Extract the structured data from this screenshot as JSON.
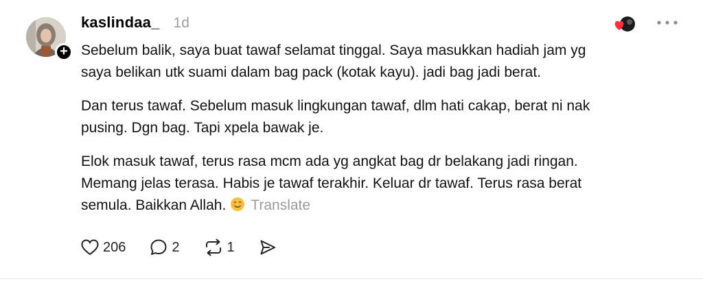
{
  "post": {
    "username": "kaslindaa_",
    "time": "1d",
    "paragraphs": [
      "Sebelum balik, saya buat tawaf selamat tinggal. Saya masukkan hadiah jam yg\nsaya belikan utk suami dalam bag pack (kotak kayu). jadi bag jadi berat.",
      "Dan terus tawaf. Sebelum masuk lingkungan tawaf, dlm hati cakap, berat ni nak\npusing. Dgn bag. Tapi xpela bawak je.",
      "Elok masuk tawaf, terus rasa mcm ada yg angkat bag dr belakang jadi ringan.\nMemang jelas terasa. Habis je tawaf terakhir. Keluar dr tawaf. Terus rasa berat\nsemula. Baikkan Allah."
    ],
    "emoji": "smiling-face-icon",
    "translate_label": "Translate"
  },
  "actions": {
    "likes": "206",
    "comments": "2",
    "reposts": "1"
  },
  "icons": {
    "like": "heart-icon",
    "comment": "comment-icon",
    "repost": "repost-icon",
    "share": "send-icon",
    "more": "more-icon",
    "follow": "plus-icon"
  },
  "colors": {
    "liked_heart": "#ff3040",
    "muted_text": "#9b9b9b"
  }
}
